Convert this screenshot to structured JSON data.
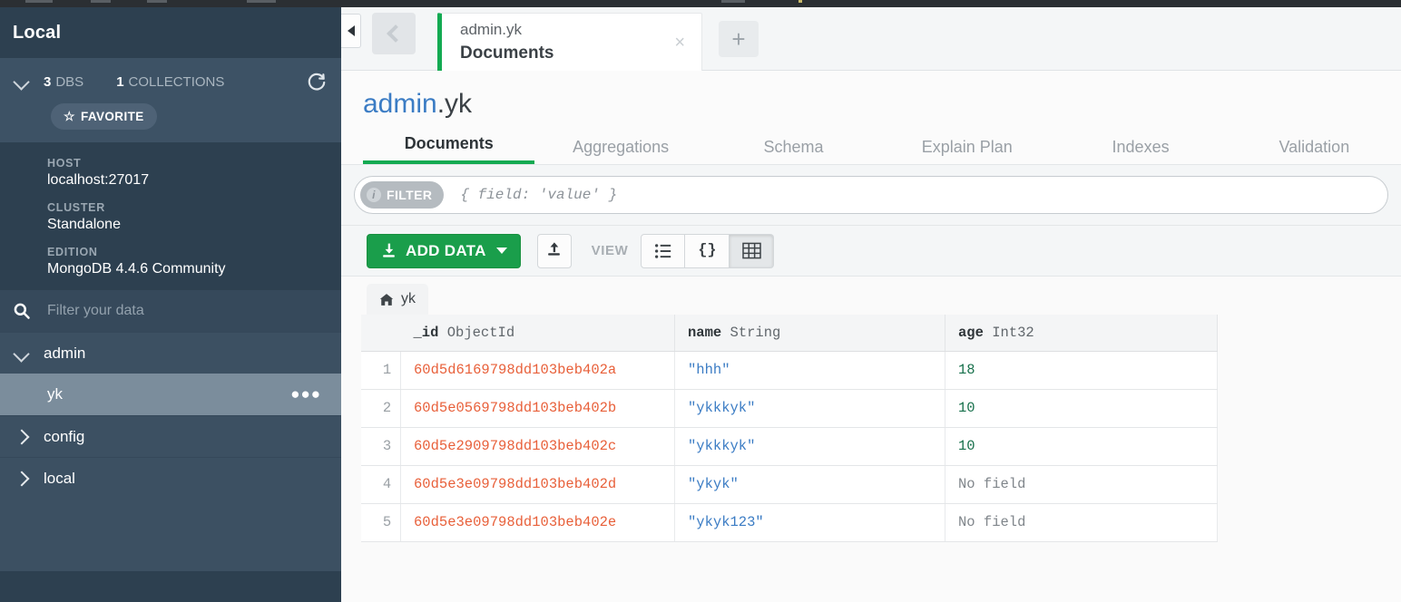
{
  "sidebar": {
    "title": "Local",
    "stats": {
      "db_count": "3",
      "db_label": "DBS",
      "coll_count": "1",
      "coll_label": "COLLECTIONS"
    },
    "favorite_label": "FAVORITE",
    "details": [
      {
        "label": "HOST",
        "value": "localhost:27017"
      },
      {
        "label": "CLUSTER",
        "value": "Standalone"
      },
      {
        "label": "EDITION",
        "value": "MongoDB 4.4.6 Community"
      }
    ],
    "filter_placeholder": "Filter your data",
    "filter_value": "",
    "tree": [
      {
        "name": "admin",
        "expanded": true,
        "collections": [
          {
            "name": "yk",
            "selected": true
          }
        ]
      },
      {
        "name": "config",
        "expanded": false,
        "collections": []
      },
      {
        "name": "local",
        "expanded": false,
        "collections": []
      }
    ]
  },
  "tabbar": {
    "tab": {
      "namespace": "admin.yk",
      "view": "Documents",
      "close_label": "×"
    },
    "new_tab_label": "+"
  },
  "header": {
    "database": "admin",
    "collection": ".yk",
    "tabs": [
      {
        "label": "Documents",
        "active": true
      },
      {
        "label": "Aggregations",
        "active": false
      },
      {
        "label": "Schema",
        "active": false
      },
      {
        "label": "Explain Plan",
        "active": false
      },
      {
        "label": "Indexes",
        "active": false
      },
      {
        "label": "Validation",
        "active": false
      }
    ]
  },
  "filter": {
    "badge_label": "FILTER",
    "info_glyph": "i",
    "placeholder": "{ field: 'value' }",
    "value": ""
  },
  "toolbar": {
    "add_data_label": "ADD DATA",
    "view_label": "VIEW",
    "view_modes": [
      {
        "name": "list",
        "glyph": "list",
        "active": false
      },
      {
        "name": "json",
        "glyph": "{}",
        "active": false
      },
      {
        "name": "table",
        "glyph": "table",
        "active": true
      }
    ]
  },
  "table": {
    "collection_tab": "yk",
    "columns": [
      {
        "field": "_id",
        "type": "ObjectId"
      },
      {
        "field": "name",
        "type": "String"
      },
      {
        "field": "age",
        "type": "Int32"
      }
    ],
    "rows": [
      {
        "num": "1",
        "_id": "60d5d6169798dd103beb402a",
        "name": "\"hhh\"",
        "age": "18",
        "age_missing": false
      },
      {
        "num": "2",
        "_id": "60d5e0569798dd103beb402b",
        "name": "\"ykkkyk\"",
        "age": "10",
        "age_missing": false
      },
      {
        "num": "3",
        "_id": "60d5e2909798dd103beb402c",
        "name": "\"ykkkyk\"",
        "age": "10",
        "age_missing": false
      },
      {
        "num": "4",
        "_id": "60d5e3e09798dd103beb402d",
        "name": "\"ykyk\"",
        "age": "No field",
        "age_missing": true
      },
      {
        "num": "5",
        "_id": "60d5e3e09798dd103beb402e",
        "name": "\"ykyk123\"",
        "age": "No field",
        "age_missing": true
      }
    ]
  },
  "colors": {
    "accent_green": "#13aa52",
    "link_blue": "#3b7cc4",
    "objectid_orange": "#e8603a",
    "number_green": "#17704b"
  }
}
